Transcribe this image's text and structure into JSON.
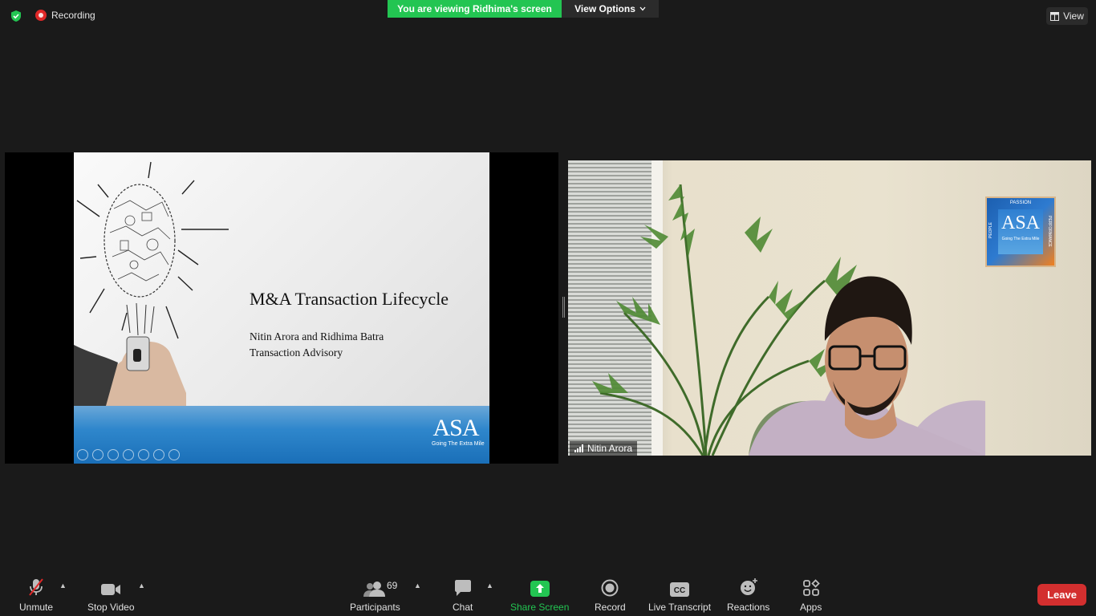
{
  "topbar": {
    "recording_label": "Recording",
    "viewing_banner": "You are viewing Ridhima's screen",
    "view_options_label": "View Options",
    "view_label": "View"
  },
  "slide": {
    "title": "M&A Transaction Lifecycle",
    "subtitle_line1": "Nitin Arora and Ridhima Batra",
    "subtitle_line2": "Transaction Advisory",
    "logo_text": "ASA",
    "logo_tagline": "Going The Extra Mile"
  },
  "video": {
    "participant_name": "Nitin Arora",
    "poster": {
      "logo_text": "ASA",
      "tagline": "Going The Extra Mile",
      "top_word": "PASSION",
      "left_word": "PEOPLE",
      "right_word": "PERFORMANCE"
    }
  },
  "toolbar": {
    "unmute": "Unmute",
    "stop_video": "Stop Video",
    "participants": "Participants",
    "participants_count": "69",
    "chat": "Chat",
    "share_screen": "Share Screen",
    "record": "Record",
    "live_transcript": "Live Transcript",
    "reactions": "Reactions",
    "apps": "Apps",
    "leave": "Leave"
  },
  "colors": {
    "accent_green": "#23c552",
    "leave_red": "#d32f2f",
    "recording_red": "#e02828",
    "background": "#1a1a1a"
  },
  "icons": {
    "security": "shield-icon",
    "recording": "record-dot-icon",
    "view": "grid-icon",
    "mic": "mic-muted-icon",
    "video": "video-camera-icon",
    "participants": "people-icon",
    "chat": "chat-bubble-icon",
    "share": "share-arrow-icon",
    "record": "record-icon",
    "transcript": "cc-icon",
    "reactions": "smiley-plus-icon",
    "apps": "apps-icon"
  }
}
